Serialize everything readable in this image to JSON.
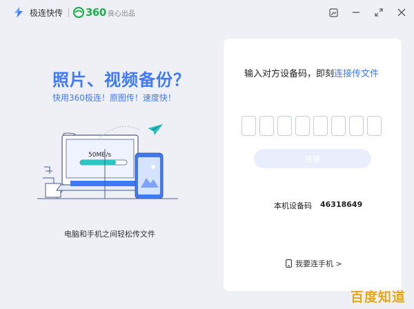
{
  "app": {
    "name": "极连快传",
    "brand_number": "360",
    "brand_slogan": "良心出品"
  },
  "window_controls": {
    "icons": [
      "skin-icon",
      "minimize-icon",
      "restore-icon",
      "close-icon"
    ]
  },
  "hero": {
    "title": "照片、视频备份？",
    "subtitle": "快用360极连！原图传！速度快！",
    "speed_label": "50MB/s",
    "caption": "电脑和手机之间轻松传文件"
  },
  "card": {
    "title_prefix": "输入对方设备码，即刻",
    "title_link": "连接传文件",
    "code_length": 8,
    "connect_button": "连接",
    "device_code_label": "本机设备码",
    "device_code_value": "46318649",
    "phone_link": "我要连手机 >"
  },
  "watermark": "百度知道",
  "colors": {
    "accent": "#3e79f7",
    "brand_green": "#1fae4e",
    "background": "#eef0f6",
    "card": "#ffffff",
    "button_disabled": "#eaeefc"
  }
}
